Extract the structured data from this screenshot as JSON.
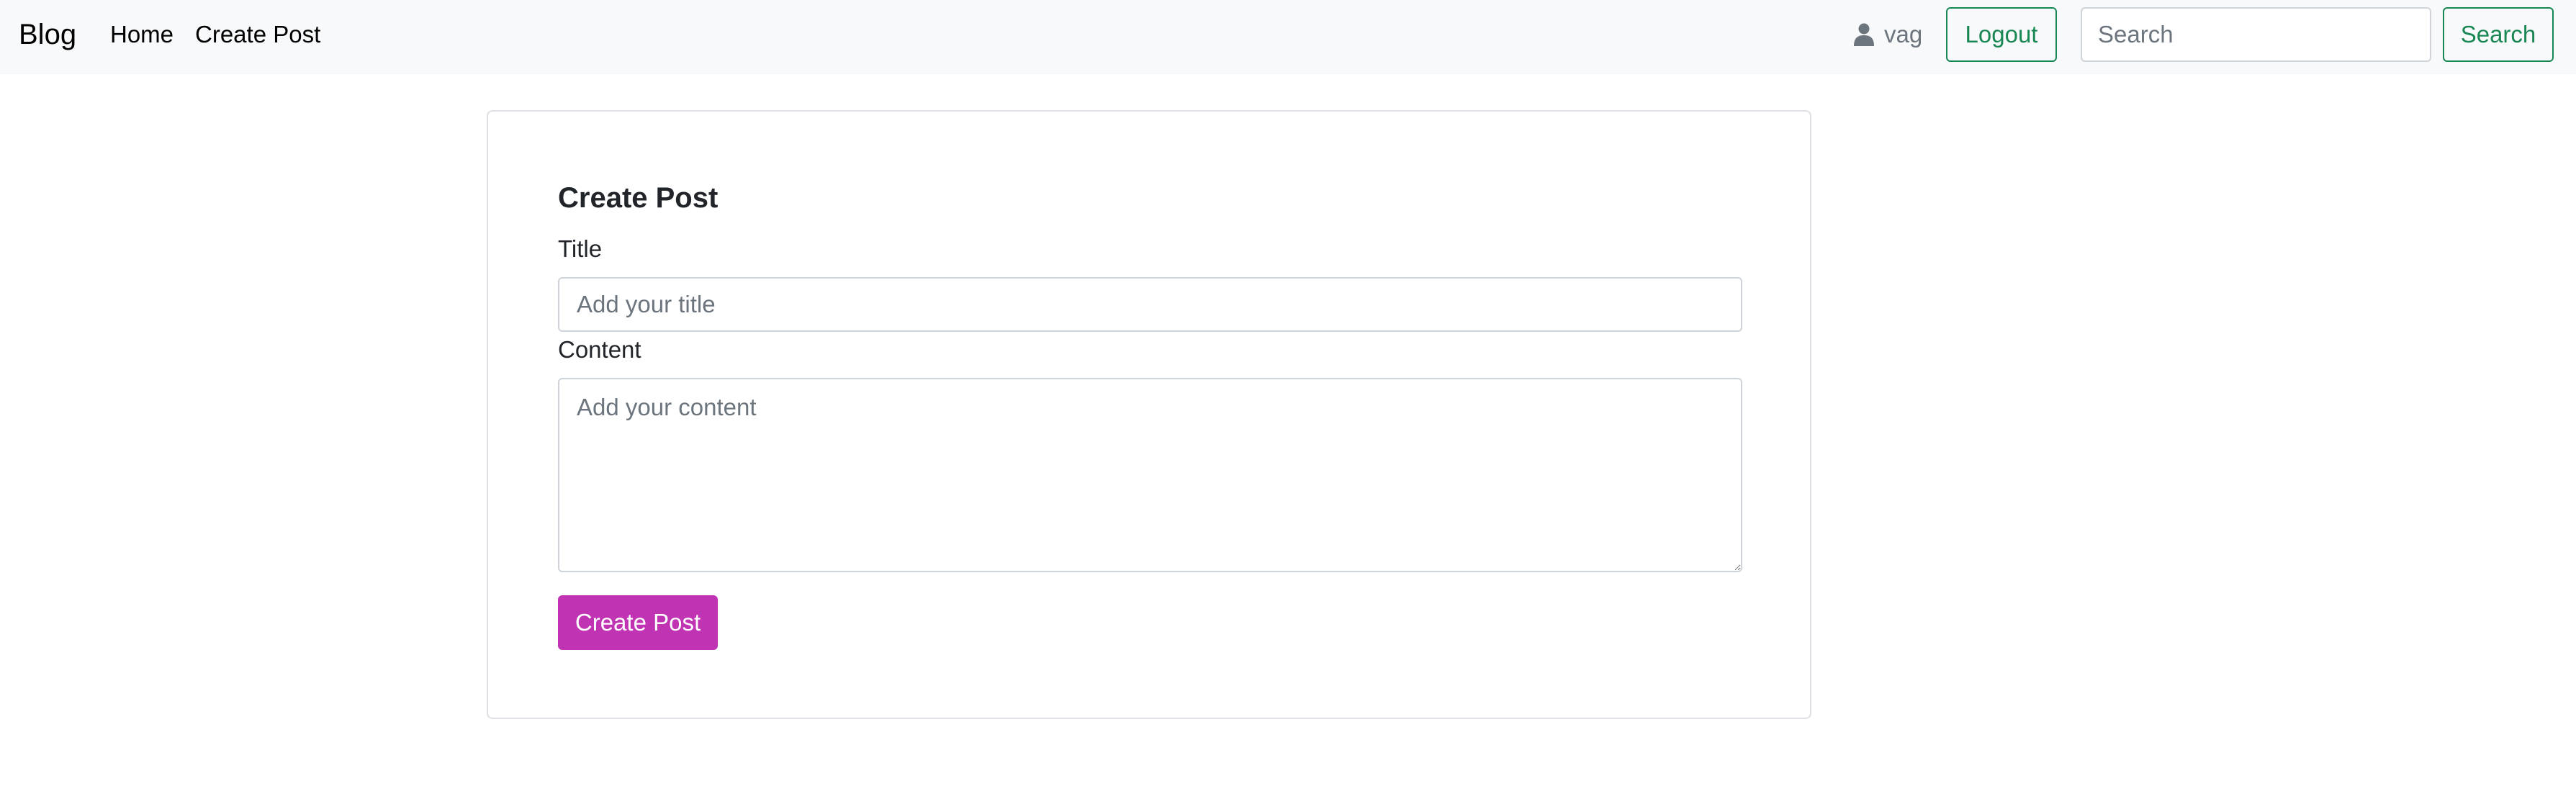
{
  "navbar": {
    "brand": "Blog",
    "links": [
      {
        "label": "Home"
      },
      {
        "label": "Create Post"
      }
    ],
    "user": {
      "icon": "user-icon",
      "name": "vag"
    },
    "logout_label": "Logout",
    "search": {
      "placeholder": "Search",
      "value": "",
      "button_label": "Search"
    },
    "accent_color": "#198754",
    "background": "#f8f9fa"
  },
  "form": {
    "heading": "Create Post",
    "title_label": "Title",
    "title_placeholder": "Add your title",
    "title_value": "",
    "content_label": "Content",
    "content_placeholder": "Add your content",
    "content_value": "",
    "submit_label": "Create Post",
    "submit_color": "#c033b3"
  }
}
